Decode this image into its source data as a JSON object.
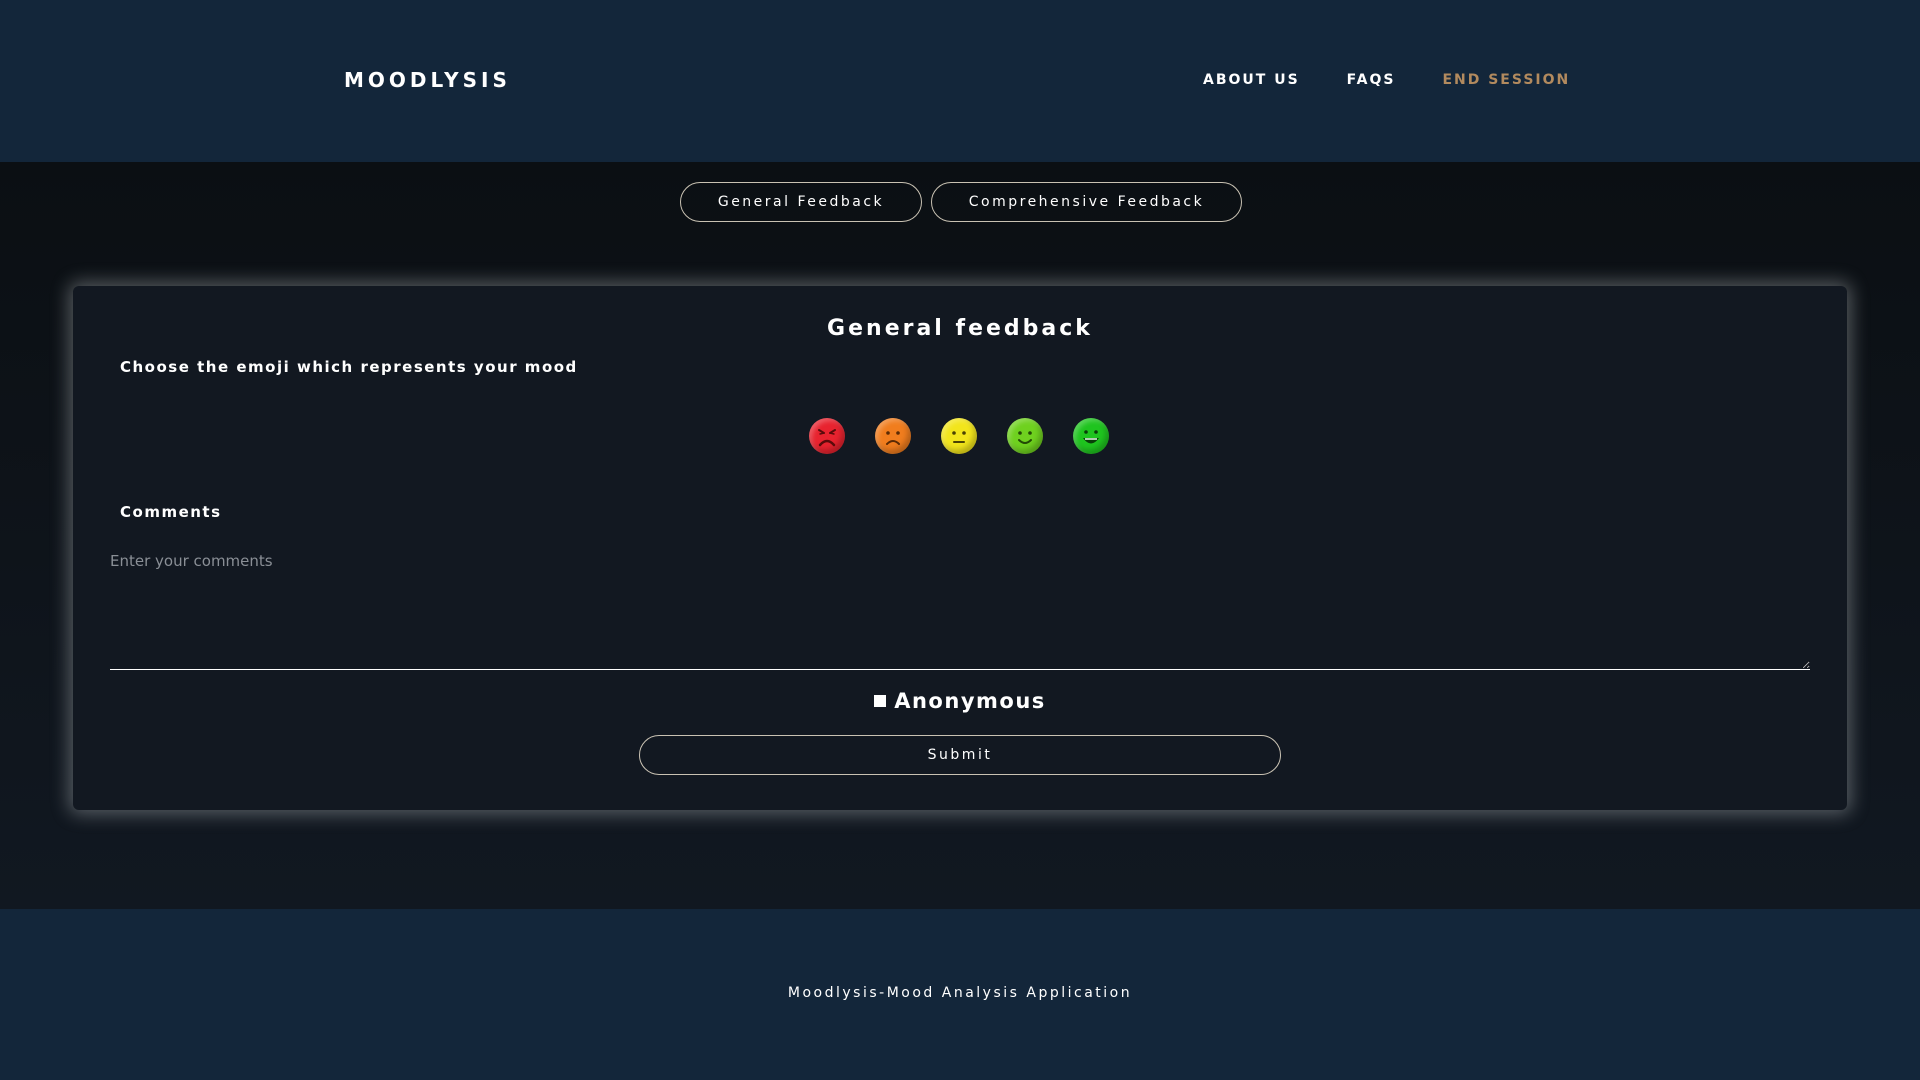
{
  "header": {
    "brand": "MOODLYSIS",
    "nav": {
      "about": "ABOUT US",
      "faqs": "FAQS",
      "end_session": "END SESSION"
    }
  },
  "tabs": {
    "general": "General Feedback",
    "comprehensive": "Comprehensive Feedback"
  },
  "card": {
    "title": "General feedback",
    "mood_prompt": "Choose the emoji which represents your mood",
    "emojis": [
      {
        "name": "angry-face-icon",
        "color": "#e8232f"
      },
      {
        "name": "sad-face-icon",
        "color": "#f07d1e"
      },
      {
        "name": "neutral-face-icon",
        "color": "#f2e51c"
      },
      {
        "name": "smiling-face-icon",
        "color": "#6fd11f"
      },
      {
        "name": "grinning-face-icon",
        "color": "#1fc41f"
      }
    ],
    "comments_label": "Comments",
    "comments_placeholder": "Enter your comments",
    "anonymous_label": "Anonymous",
    "submit_label": "Submit"
  },
  "footer": {
    "text": "Moodlysis-Mood Analysis Application"
  },
  "colors": {
    "header_bg": "#13263a",
    "accent_end_session": "#b28a5e",
    "card_bg": "#121821"
  }
}
